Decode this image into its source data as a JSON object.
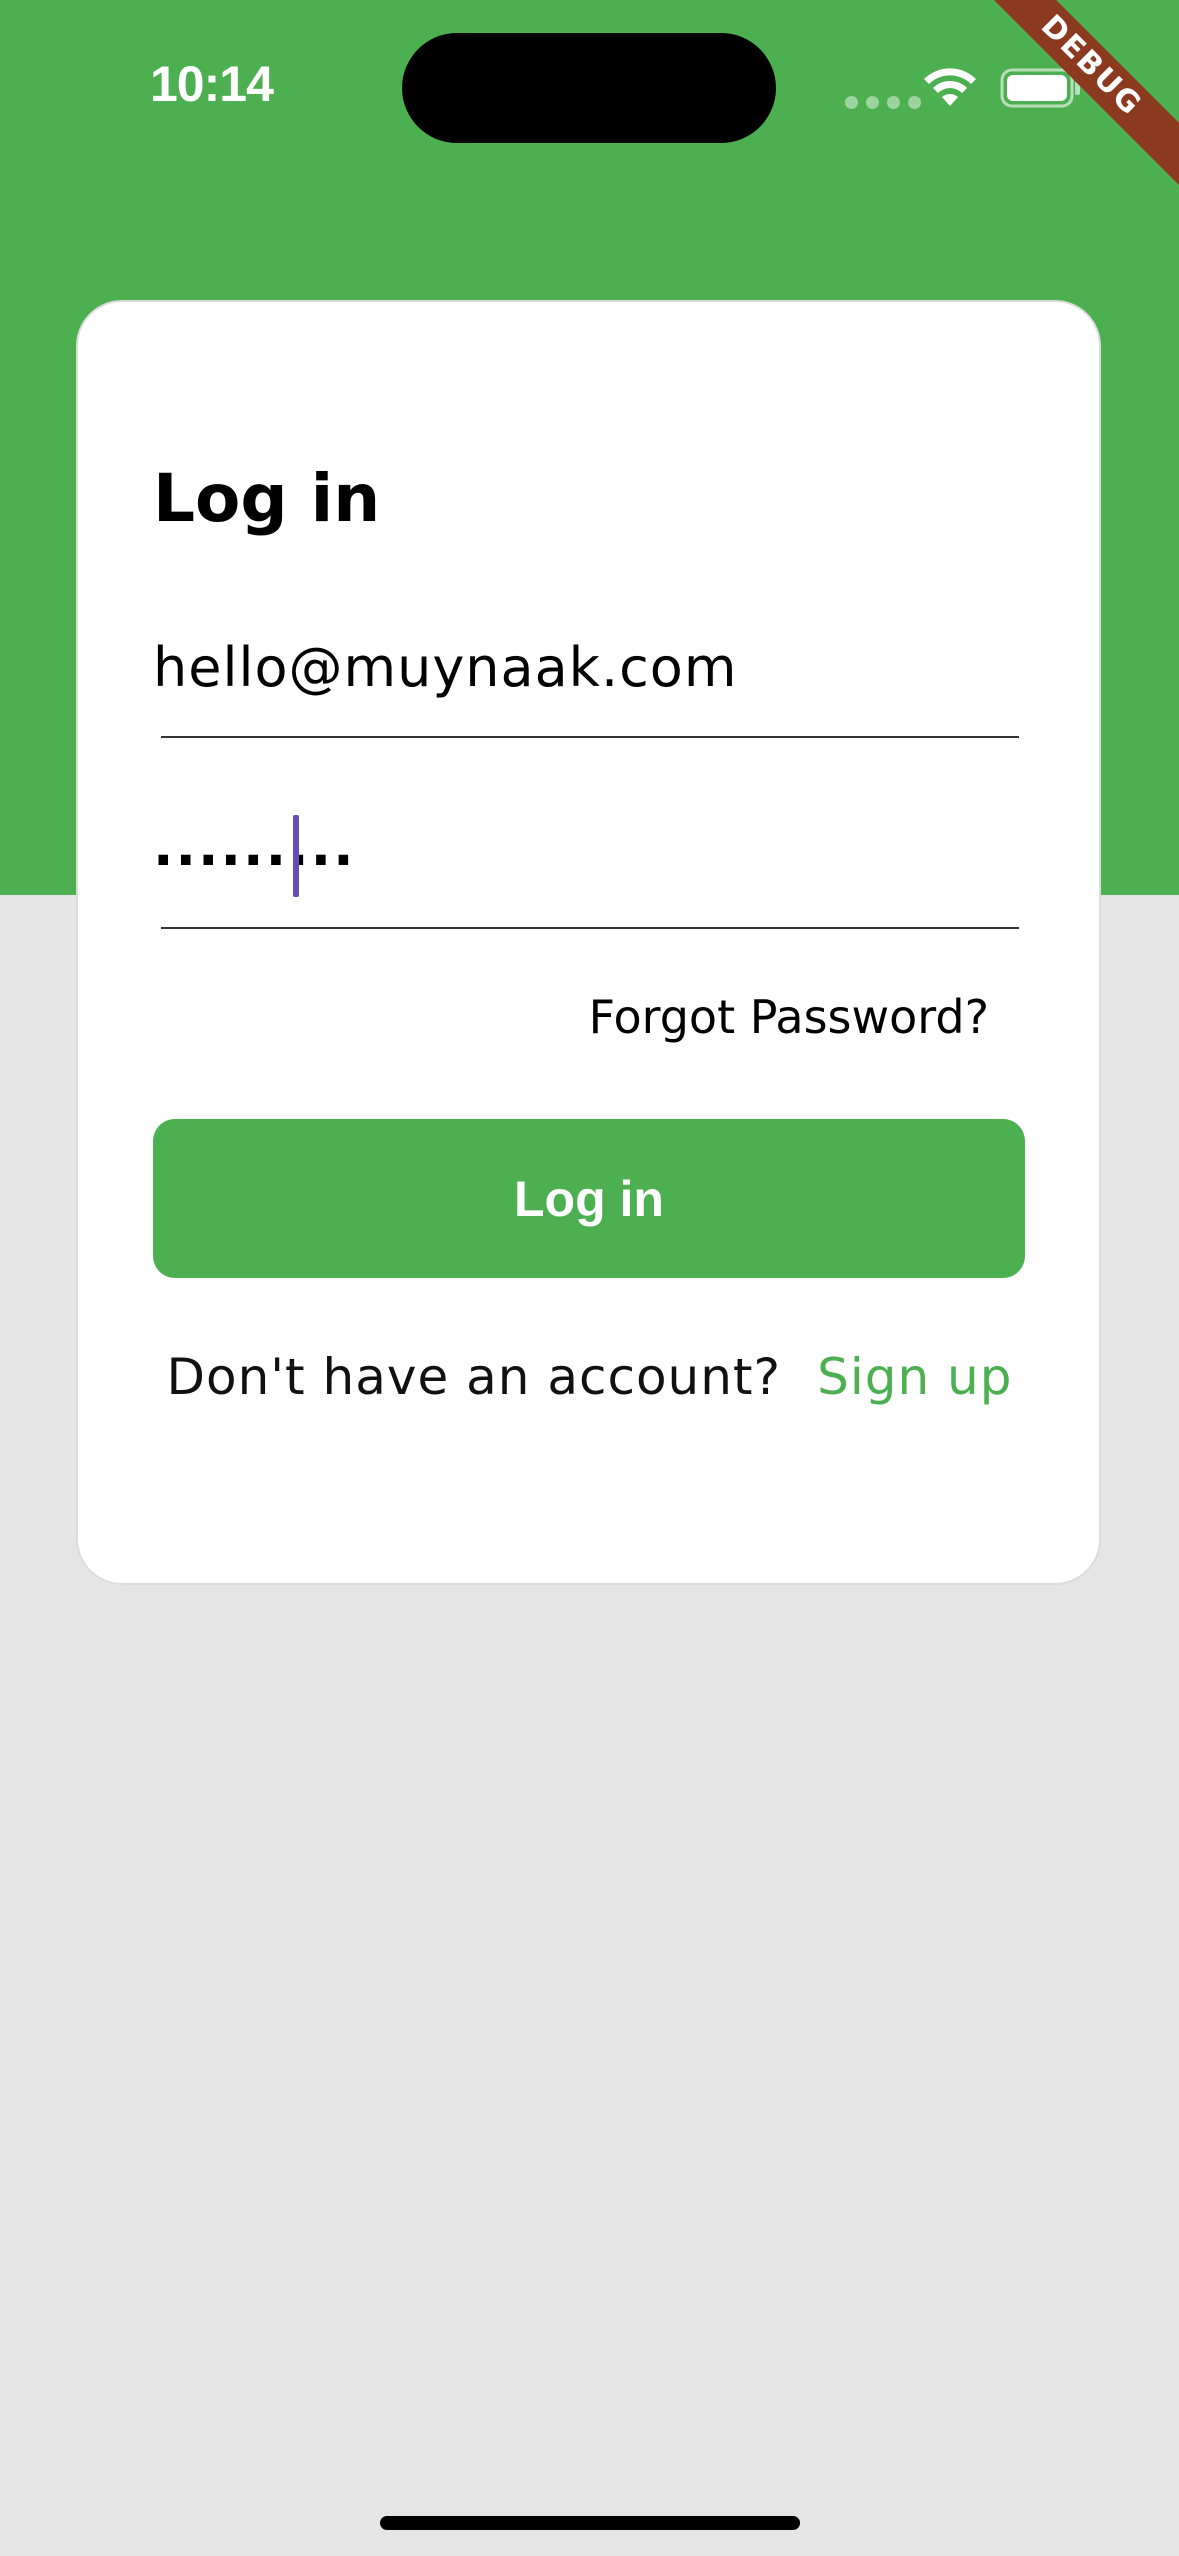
{
  "status_bar": {
    "time": "10:14"
  },
  "debug_banner": "DEBUG",
  "login_card": {
    "title": "Log in",
    "email": {
      "value": "hello@muynaak.com"
    },
    "password": {
      "masked_value": "·········"
    },
    "forgot_password_label": "Forgot Password?",
    "login_button_label": "Log in",
    "signup_prompt": "Don't have an account?",
    "signup_link_label": "Sign up"
  },
  "colors": {
    "brand_green": "#4caf50",
    "background": "#e5e5e5",
    "cursor": "#6a4bb6",
    "debug_banner": "#8b3a20"
  },
  "icons": [
    "wifi-icon",
    "battery-icon",
    "signal-icon"
  ]
}
